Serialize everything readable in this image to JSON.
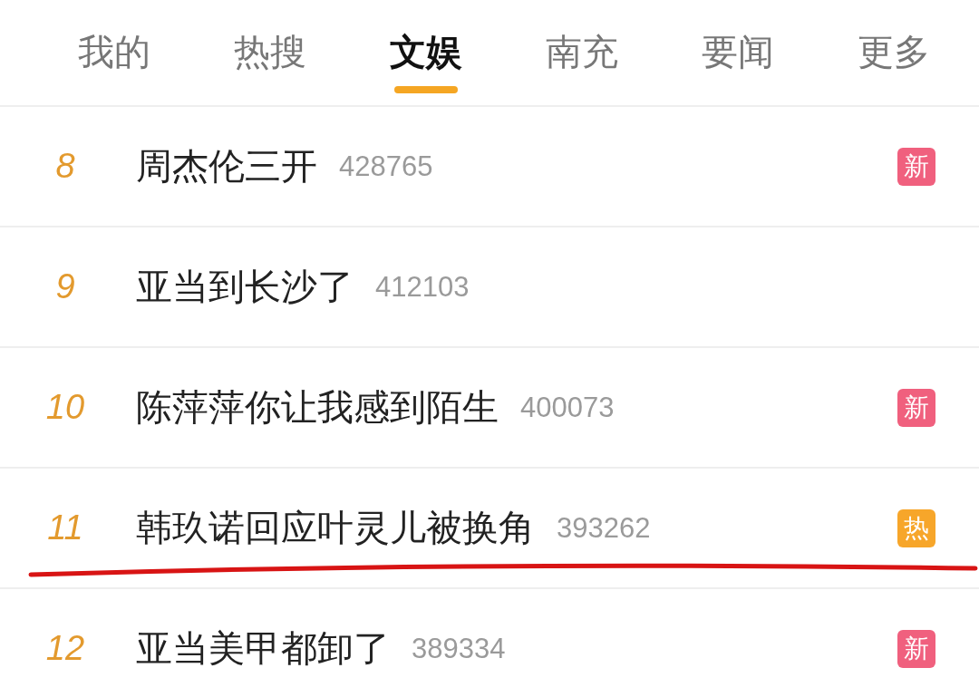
{
  "tabs": [
    {
      "label": "我的",
      "selected": false
    },
    {
      "label": "热搜",
      "selected": false
    },
    {
      "label": "文娱",
      "selected": true
    },
    {
      "label": "南充",
      "selected": false
    },
    {
      "label": "要闻",
      "selected": false
    },
    {
      "label": "更多",
      "selected": false
    }
  ],
  "rows": [
    {
      "rank": "8",
      "title": "周杰伦三开",
      "count": "428765",
      "badge": {
        "text": "新",
        "kind": "new"
      },
      "underlined": false
    },
    {
      "rank": "9",
      "title": "亚当到长沙了",
      "count": "412103",
      "underlined": false
    },
    {
      "rank": "10",
      "title": "陈萍萍你让我感到陌生",
      "count": "400073",
      "badge": {
        "text": "新",
        "kind": "new"
      },
      "underlined": false
    },
    {
      "rank": "11",
      "title": "韩玖诺回应叶灵儿被换角",
      "count": "393262",
      "badge": {
        "text": "热",
        "kind": "hot"
      },
      "underlined": true
    },
    {
      "rank": "12",
      "title": "亚当美甲都卸了",
      "count": "389334",
      "badge": {
        "text": "新",
        "kind": "new"
      },
      "underlined": false
    }
  ]
}
